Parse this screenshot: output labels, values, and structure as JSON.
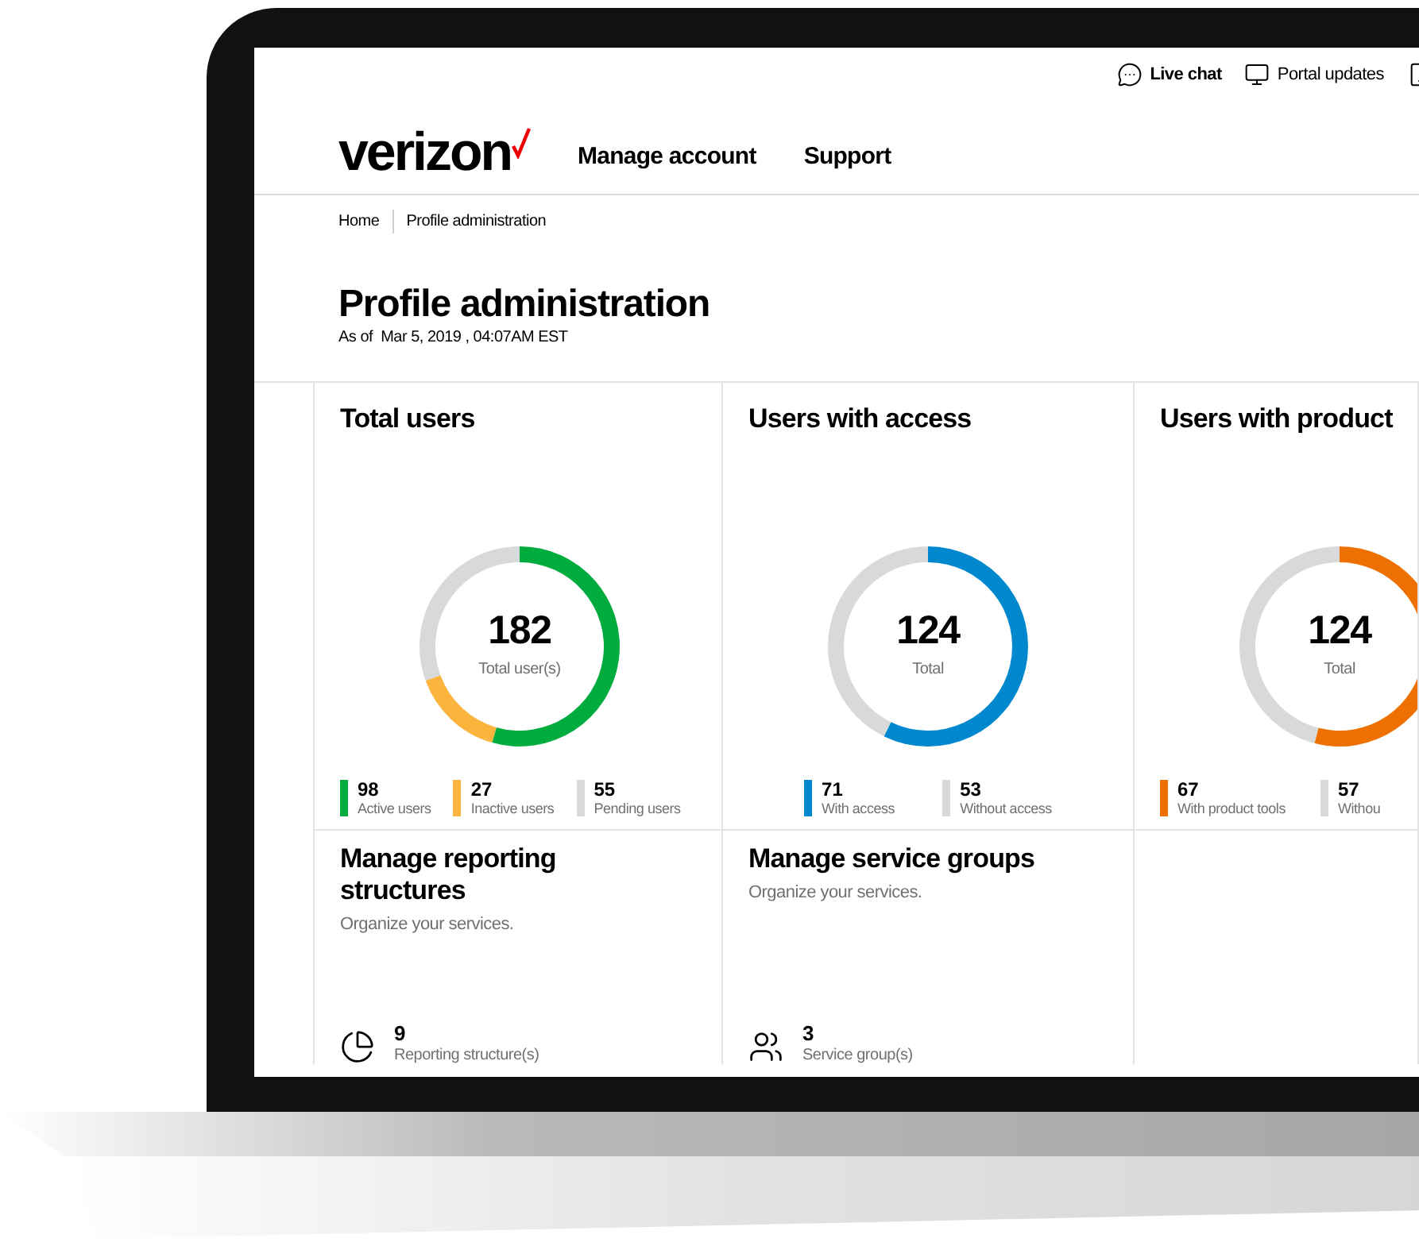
{
  "top_links": [
    {
      "kind": "chat",
      "label": "Live chat"
    },
    {
      "kind": "monitor",
      "label": "Portal updates"
    },
    {
      "kind": "phone"
    }
  ],
  "logo": {
    "text": "verizon"
  },
  "nav": [
    "Manage account",
    "Support"
  ],
  "breadcrumb": [
    "Home",
    "Profile administration"
  ],
  "page": {
    "title": "Profile administration",
    "subtitle": "As of  Mar 5, 2019 , 04:07AM EST"
  },
  "stat_cards": [
    {
      "title": "Total users",
      "total": "182",
      "total_label": "Total user(s)",
      "legend": [
        {
          "value": "98",
          "label": "Active users",
          "color": "#00ac3e"
        },
        {
          "value": "27",
          "label": "Inactive users",
          "color": "#fbb53f"
        },
        {
          "value": "55",
          "label": "Pending users",
          "color": "#d8dada"
        }
      ]
    },
    {
      "title": "Users with access",
      "total": "124",
      "total_label": "Total",
      "legend": [
        {
          "value": "71",
          "label": "With access",
          "color": "#0088ce"
        },
        {
          "value": "53",
          "label": "Without access",
          "color": "#d8dada"
        }
      ]
    },
    {
      "title": "Users with product",
      "total": "124",
      "total_label": "Total",
      "legend": [
        {
          "value": "67",
          "label": "With product tools",
          "color": "#ed7000"
        },
        {
          "value": "57",
          "label": "Withou",
          "color": "#d8dada"
        }
      ]
    }
  ],
  "manage_cards": [
    {
      "kind": "reporting",
      "title": "Manage reporting structures",
      "description": "Organize your services.",
      "count": "9",
      "count_label": "Reporting structure(s)"
    },
    {
      "kind": "groups",
      "title": "Manage service groups",
      "description": "Organize your services.",
      "count": "3",
      "count_label": "Service group(s)"
    }
  ]
}
